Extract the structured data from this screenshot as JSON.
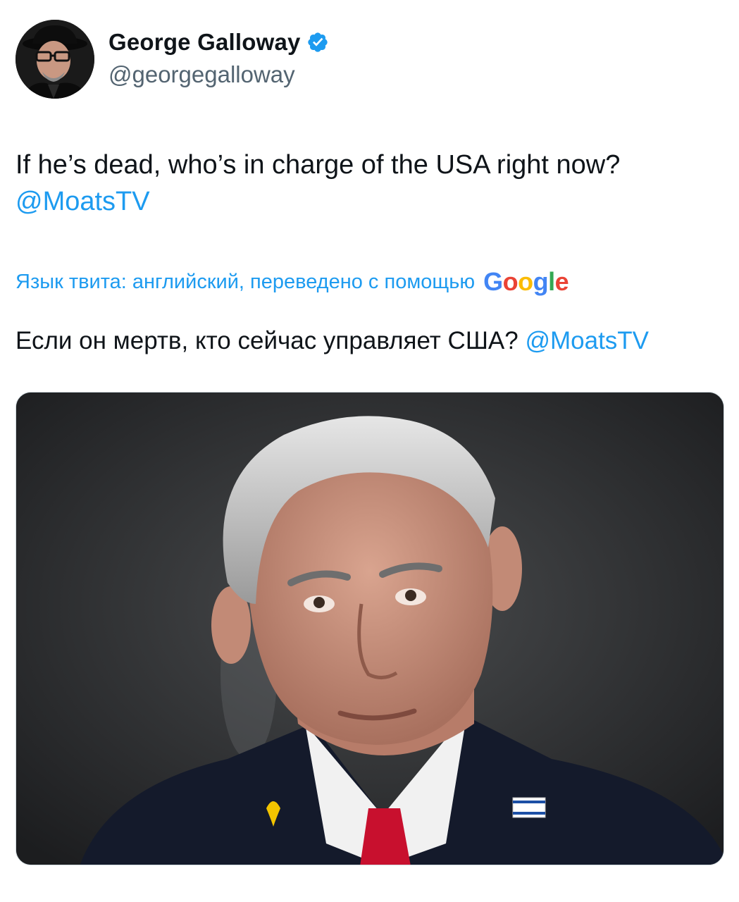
{
  "tweet": {
    "author": {
      "display_name": "George Galloway",
      "handle": "@georgegalloway",
      "verified": true,
      "verified_icon": "verified-badge-icon"
    },
    "text_line_1": "If he’s dead, who’s in charge of the USA right now?",
    "text_mention": "@MoatsTV",
    "translation": {
      "note": "Язык твита: английский, переведено с помощью",
      "provider": "Google",
      "translated_text": "Если он мертв, кто сейчас управляет США?",
      "translated_mention": "@MoatsTV"
    }
  },
  "colors": {
    "link": "#1d9bf0",
    "text": "#0f1419",
    "secondary": "#536471",
    "verified": "#1d9bf0"
  }
}
